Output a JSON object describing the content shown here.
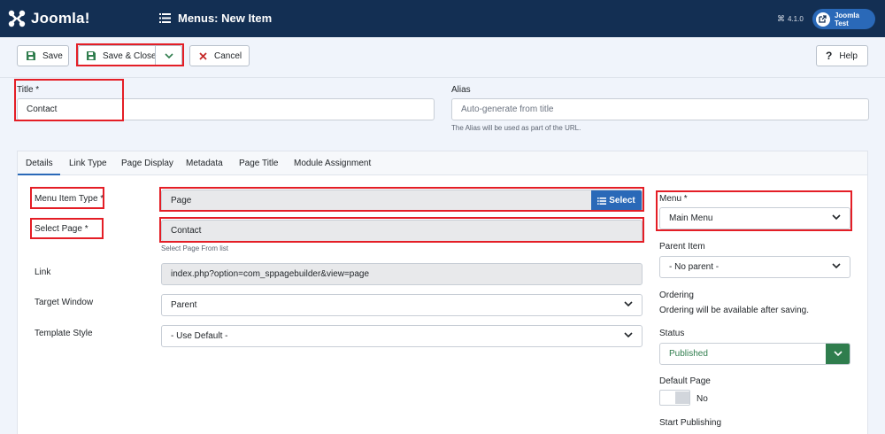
{
  "app": {
    "logo_text": "Joomla!",
    "page_title": "Menus: New Item",
    "version": "4.1.0",
    "user_label": "Joomla Test"
  },
  "toolbar": {
    "save_label": "Save",
    "save_close_label": "Save & Close",
    "cancel_label": "Cancel",
    "help_label": "Help"
  },
  "form": {
    "title_label": "Title *",
    "title_value": "Contact",
    "alias_label": "Alias",
    "alias_placeholder": "Auto-generate from title",
    "alias_hint": "The Alias will be used as part of the URL."
  },
  "tabs": [
    "Details",
    "Link Type",
    "Page Display",
    "Metadata",
    "Page Title",
    "Module Assignment"
  ],
  "details": {
    "menu_item_type_label": "Menu Item Type *",
    "menu_item_type_value": "Page",
    "select_button_label": "Select",
    "select_page_label": "Select Page *",
    "select_page_value": "Contact",
    "select_page_hint": "Select Page From list",
    "link_label": "Link",
    "link_value": "index.php?option=com_sppagebuilder&view=page",
    "target_window_label": "Target Window",
    "target_window_value": "Parent",
    "template_style_label": "Template Style",
    "template_style_value": "- Use Default -"
  },
  "side": {
    "menu_label": "Menu *",
    "menu_value": "Main Menu",
    "parent_label": "Parent Item",
    "parent_value": "- No parent -",
    "ordering_label": "Ordering",
    "ordering_text": "Ordering will be available after saving.",
    "status_label": "Status",
    "status_value": "Published",
    "default_page_label": "Default Page",
    "default_page_value": "No",
    "start_publishing_label": "Start Publishing"
  },
  "colors": {
    "topbar": "#132f53",
    "accent": "#2a69b8",
    "published": "#2f7d4d",
    "highlight": "#e41e26"
  }
}
